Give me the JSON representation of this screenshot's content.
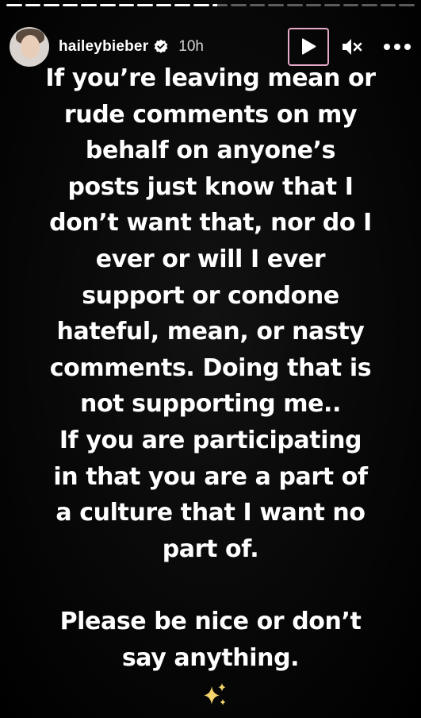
{
  "progress": {
    "segments": [
      1,
      1,
      1,
      1,
      1,
      1,
      1,
      1,
      1,
      1,
      1,
      0.35,
      0,
      0,
      0,
      0,
      0,
      0,
      0,
      0,
      0,
      0
    ]
  },
  "header": {
    "username": "haileybieber",
    "time_ago": "10h",
    "verified": true,
    "icons": {
      "verified": "verified-badge-icon",
      "play": "play-icon",
      "mute": "mute-icon",
      "more": "more-icon"
    }
  },
  "story": {
    "lines": [
      "If you’re leaving mean or",
      "rude comments on my",
      "behalf on anyone’s",
      "posts just know that I",
      "don’t want that, nor do I",
      "ever or will I ever",
      "support or condone",
      "hateful, mean, or nasty",
      "comments. Doing that is",
      "not supporting me..",
      "If you are participating",
      "in that you are a part of",
      "a culture that I want no",
      "part of.",
      "",
      "Please be nice or don’t",
      "say anything."
    ],
    "sparkles": "sparkles-icon"
  },
  "colors": {
    "play_highlight": "#e5a8c6",
    "sparkles": "#f3d36b"
  }
}
